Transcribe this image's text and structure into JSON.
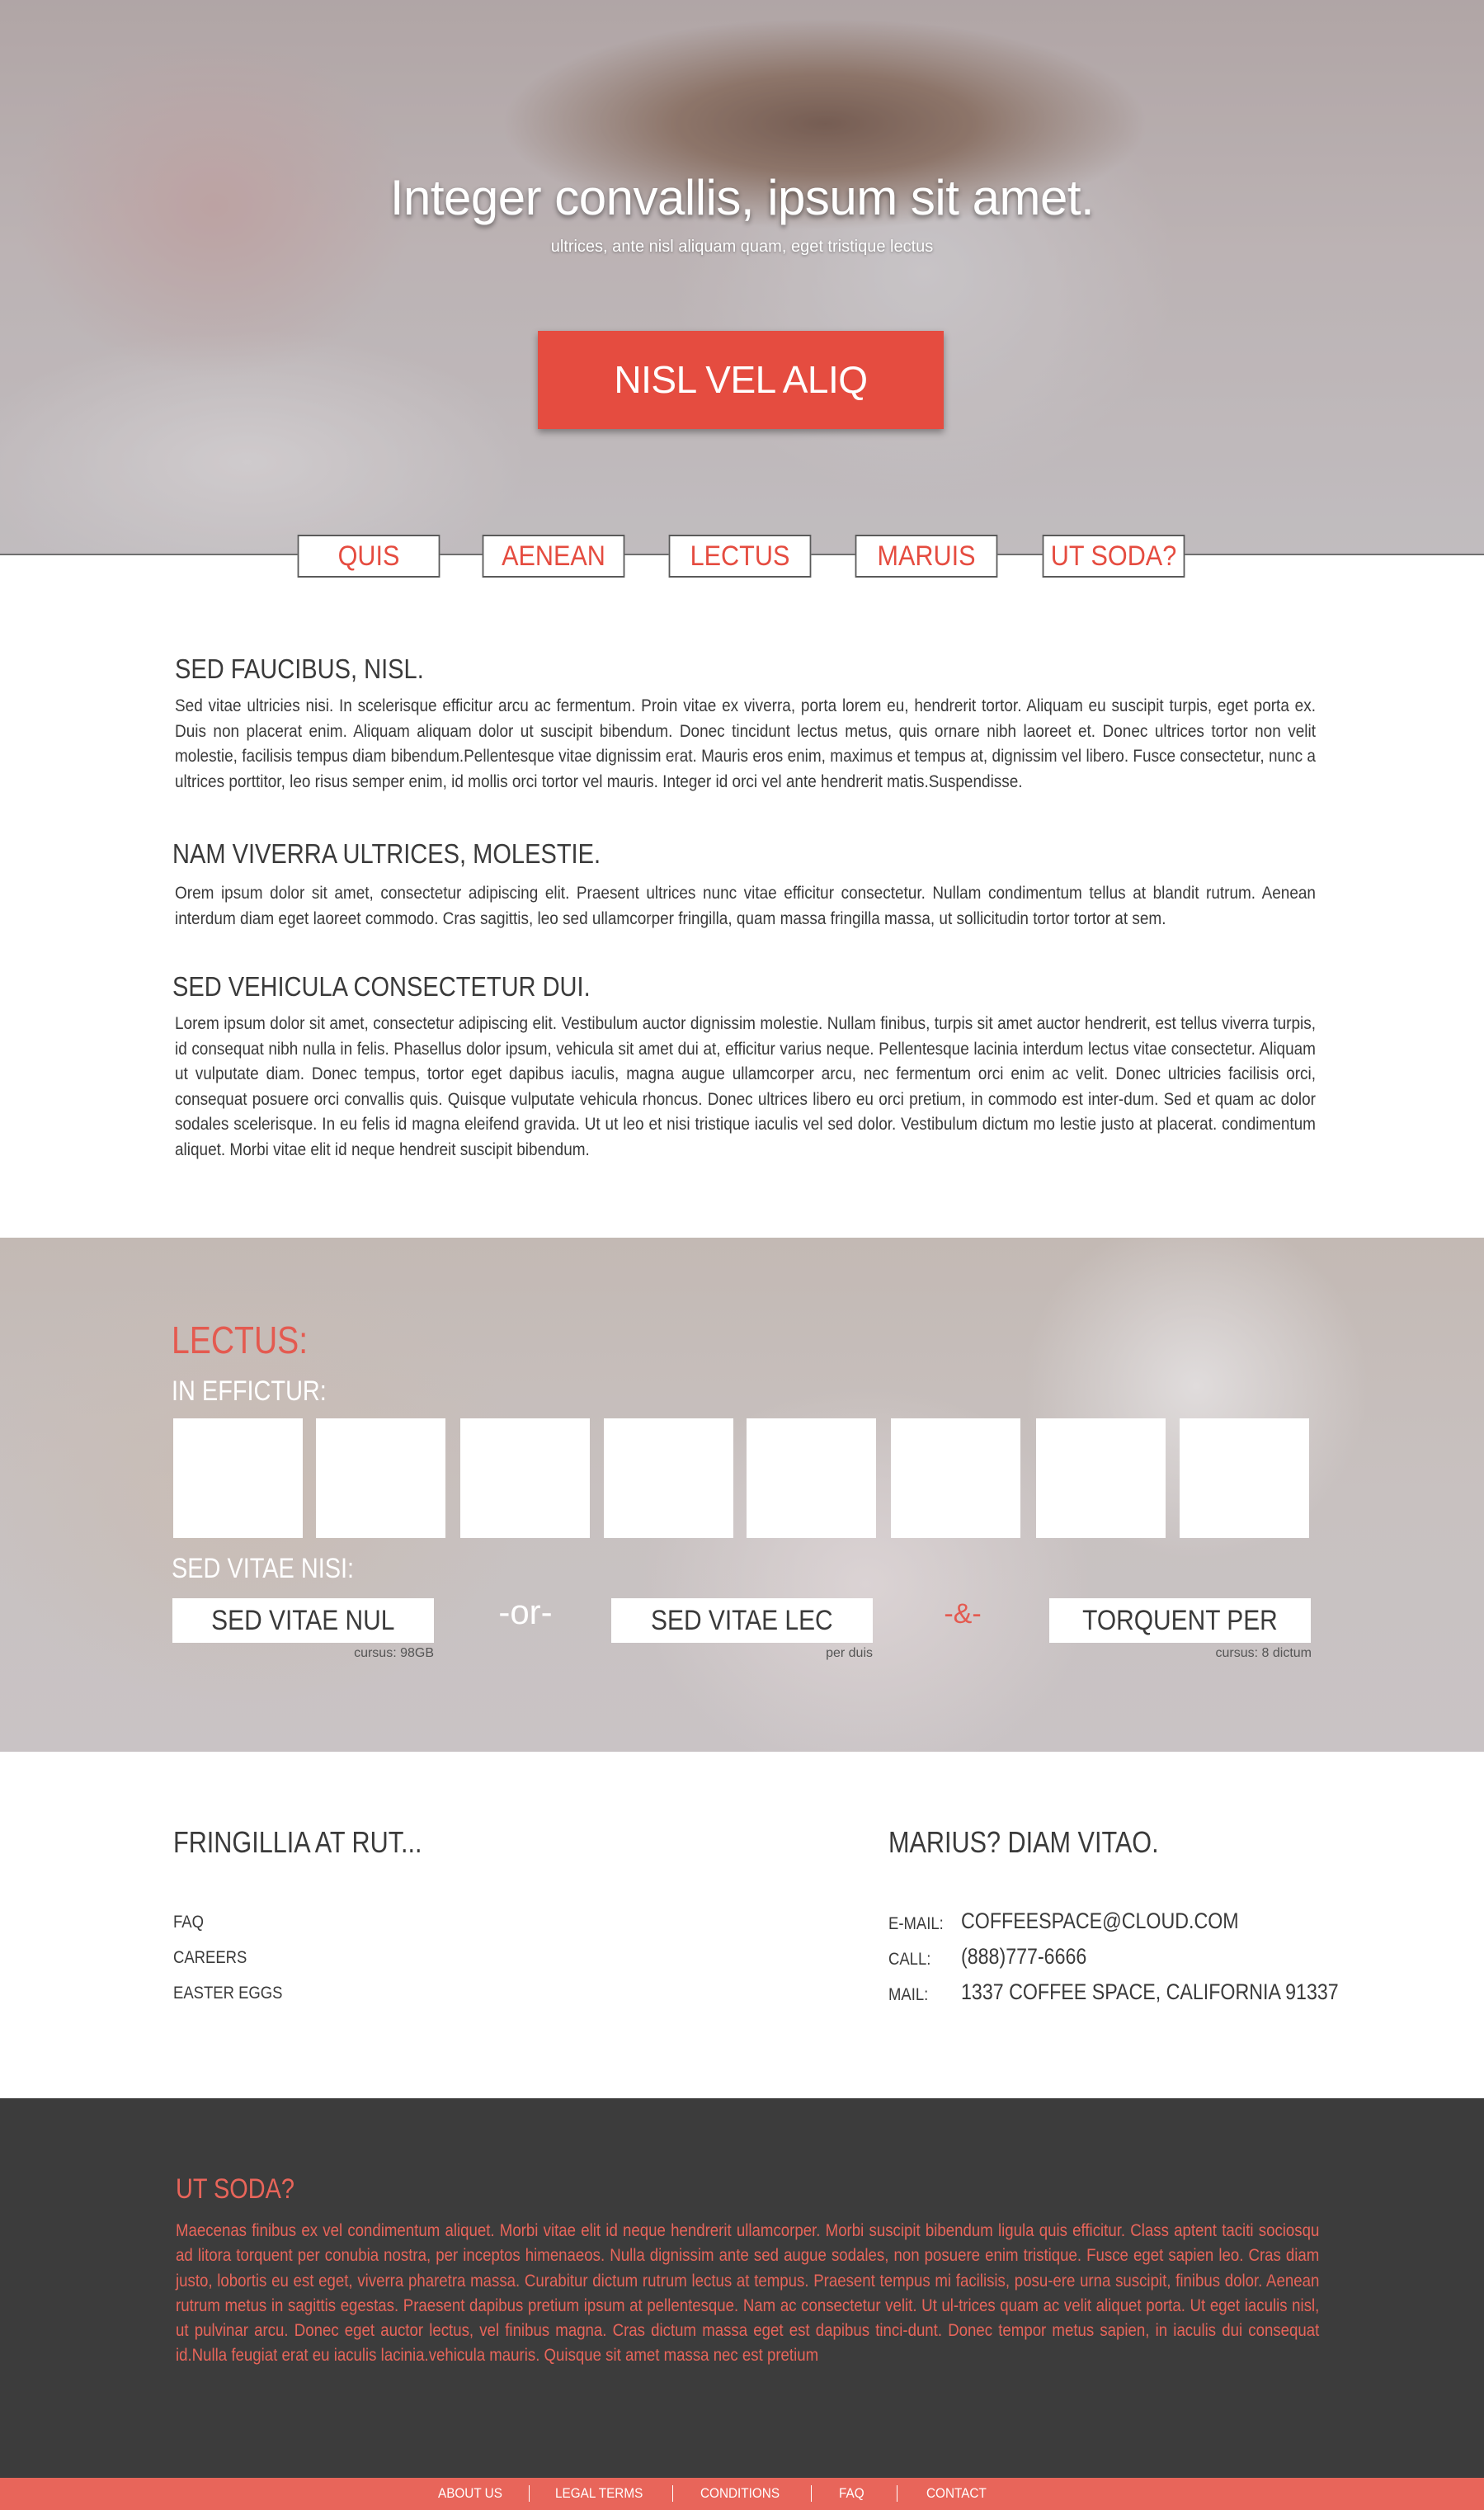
{
  "hero": {
    "title": "Integer convallis, ipsum sit amet.",
    "subtitle": "ultrices, ante nisl aliquam quam, eget tristique lectus",
    "cta_label": "NISL VEL ALIQ"
  },
  "nav": {
    "tabs": [
      {
        "label": "QUIS"
      },
      {
        "label": "AENEAN"
      },
      {
        "label": "LECTUS"
      },
      {
        "label": "MARUIS"
      },
      {
        "label": "UT SODA?"
      }
    ]
  },
  "articles": [
    {
      "title": "SED FAUCIBUS, NISL.",
      "body": "Sed vitae ultricies nisi. In scelerisque efficitur arcu ac fermentum. Proin vitae ex viverra, porta lorem eu, hendrerit tortor. Aliquam eu suscipit turpis, eget porta ex. Duis non placerat enim. Aliquam aliquam dolor ut suscipit bibendum. Donec tincidunt lectus metus, quis ornare nibh laoreet et. Donec ultrices tortor non velit molestie, facilisis tempus diam bibendum.Pellentesque vitae dignissim erat. Mauris eros enim, maximus et tempus at, dignissim vel libero. Fusce consectetur, nunc a ultrices porttitor, leo risus semper enim, id mollis orci tortor vel mauris. Integer id orci vel ante hendrerit matis.Suspendisse."
    },
    {
      "title": "NAM VIVERRA ULTRICES, MOLESTIE.",
      "body": "Orem ipsum dolor sit amet, consectetur adipiscing elit. Praesent ultrices nunc vitae efficitur consectetur. Nullam condimentum tellus at blandit rutrum. Aenean interdum diam eget laoreet commodo. Cras sagittis, leo sed ullamcorper fringilla, quam massa fringilla massa, ut sollicitudin tortor tortor at sem."
    },
    {
      "title": "SED VEHICULA CONSECTETUR DUI.",
      "body": "Lorem ipsum dolor sit amet, consectetur adipiscing elit. Vestibulum auctor dignissim molestie. Nullam finibus, turpis sit amet auctor hendrerit, est tellus viverra turpis, id consequat nibh nulla in felis. Phasellus dolor ipsum, vehicula sit amet dui at, efficitur varius neque. Pellentesque lacinia interdum lectus vitae consectetur. Aliquam ut vulputate diam. Donec tempus, tortor eget dapibus iaculis, magna augue ullamcorper arcu, nec fermentum orci enim ac velit. Donec ultricies facilisis orci, consequat posuere orci convallis quis. Quisque vulputate vehicula rhoncus. Donec ultrices libero eu orci pretium, in commodo est inter-dum. Sed et quam ac dolor sodales scelerisque. In eu felis id magna eleifend gravida. Ut ut leo et nisi tristique iaculis vel sed dolor. Vestibulum dictum mo lestie justo at placerat. condimentum aliquet. Morbi vitae elit id neque hendreit  suscipit bibendum."
    }
  ],
  "lectus": {
    "heading": "LECTUS:",
    "sub1": "IN EFFICTUR:",
    "sub2": "SED VITAE NISI:",
    "options": [
      {
        "label": "SED VITAE NUL",
        "caption": "cursus: 98GB"
      },
      {
        "label": "SED VITAE LEC",
        "caption": "per duis"
      },
      {
        "label": "TORQUENT PER",
        "caption": "cursus: 8 dictum"
      }
    ],
    "separators": [
      "-or-",
      "-&-"
    ],
    "colors": {
      "accent": "#e45a50",
      "white": "#ffffff"
    }
  },
  "info": {
    "left_title": "FRINGILLIA AT RUT...",
    "links": [
      "FAQ",
      "CAREERS",
      "EASTER EGGS"
    ],
    "right_title": "MARIUS? DIAM VITAO.",
    "contact": [
      {
        "label": "E-MAIL:",
        "value": "COFFEESPACE@CLOUD.COM"
      },
      {
        "label": "CALL:",
        "value": "(888)777-6666"
      },
      {
        "label": "MAIL:",
        "value": "1337 COFFEE SPACE, CALIFORNIA 91337"
      }
    ]
  },
  "about": {
    "title": "UT SODA?",
    "body": "Maecenas finibus ex vel condimentum aliquet. Morbi vitae elit id neque hendrerit ullamcorper. Morbi suscipit bibendum ligula quis efficitur. Class aptent taciti sociosqu ad litora torquent per conubia nostra, per inceptos himenaeos. Nulla dignissim ante sed augue sodales, non posuere enim tristique. Fusce eget sapien leo. Cras diam justo, lobortis eu est eget, viverra pharetra massa. Curabitur dictum rutrum lectus at tempus. Praesent tempus mi facilisis, posu-ere urna suscipit, finibus dolor. Aenean rutrum metus in sagittis egestas. Praesent dapibus pretium ipsum at pellentesque. Nam ac consectetur velit. Ut ul-trices quam ac velit aliquet porta. Ut eget iaculis nisl, ut pulvinar arcu. Donec eget auctor lectus, vel finibus magna. Cras dictum massa eget est dapibus tinci-dunt. Donec tempor metus sapien, in iaculis dui consequat id.Nulla feugiat erat eu iaculis lacinia.vehicula mauris. Quisque sit amet massa nec est pretium"
  },
  "footer": {
    "links": [
      "ABOUT US",
      "LEGAL TERMS",
      "CONDITIONS",
      "FAQ",
      "CONTACT"
    ]
  },
  "theme": {
    "accent": "#e54c40",
    "dark": "#3c3c3c",
    "footer": "#e8655a"
  }
}
